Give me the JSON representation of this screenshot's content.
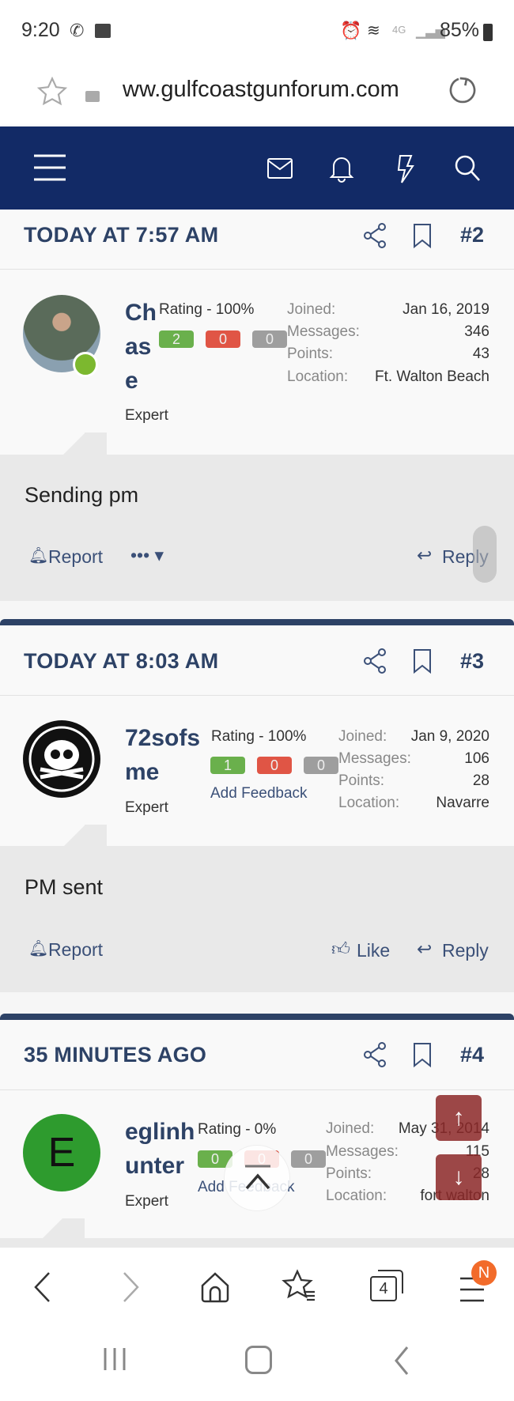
{
  "status_bar": {
    "time": "9:20",
    "battery": "85%",
    "network": "4G"
  },
  "browser": {
    "url": "ww.gulfcoastgunforum.com",
    "tab_count": "4",
    "menu_badge": "N"
  },
  "posts": [
    {
      "time": "TODAY AT 7:57 AM",
      "number": "#2",
      "name_lines": [
        "Ch",
        "as",
        "e"
      ],
      "title": "Expert",
      "rating": "Rating - 100%",
      "positive": "2",
      "negative": "0",
      "neutral": "0",
      "online": true,
      "info": {
        "joined_label": "Joined:",
        "joined": "Jan 16, 2019",
        "messages_label": "Messages:",
        "messages": "346",
        "points_label": "Points:",
        "points": "43",
        "location_label": "Location:",
        "location": "Ft. Walton Beach"
      },
      "message": "Sending pm",
      "report": "Report",
      "reply": "Reply"
    },
    {
      "time": "TODAY AT 8:03 AM",
      "number": "#3",
      "name_lines": [
        "72sofs",
        "me"
      ],
      "title": "Expert",
      "rating": "Rating - 100%",
      "positive": "1",
      "negative": "0",
      "neutral": "0",
      "add_feedback": "Add Feedback",
      "info": {
        "joined_label": "Joined:",
        "joined": "Jan 9, 2020",
        "messages_label": "Messages:",
        "messages": "106",
        "points_label": "Points:",
        "points": "28",
        "location_label": "Location:",
        "location": "Navarre"
      },
      "message": "PM sent",
      "report": "Report",
      "like": "Like",
      "reply": "Reply"
    },
    {
      "time": "35 MINUTES AGO",
      "number": "#4",
      "name_lines": [
        "eglinh",
        "unter"
      ],
      "avatar_letter": "E",
      "title": "Expert",
      "rating": "Rating - 0%",
      "positive": "0",
      "negative": "0",
      "neutral": "0",
      "add_feedback": "Add Feedback",
      "info": {
        "joined_label": "Joined:",
        "joined": "May 31, 2014",
        "messages_label": "Messages:",
        "messages": "115",
        "points_label": "Points:",
        "points": "28",
        "location_label": "Location:",
        "location": "fort walton"
      }
    }
  ],
  "colors": {
    "nav": "#122a66",
    "heading": "#2d4266",
    "positive": "#6ab04c",
    "negative": "#e05545",
    "neutral": "#9e9e9e",
    "avatar_e": "#2e9b2e",
    "badge": "#f26b2a"
  }
}
